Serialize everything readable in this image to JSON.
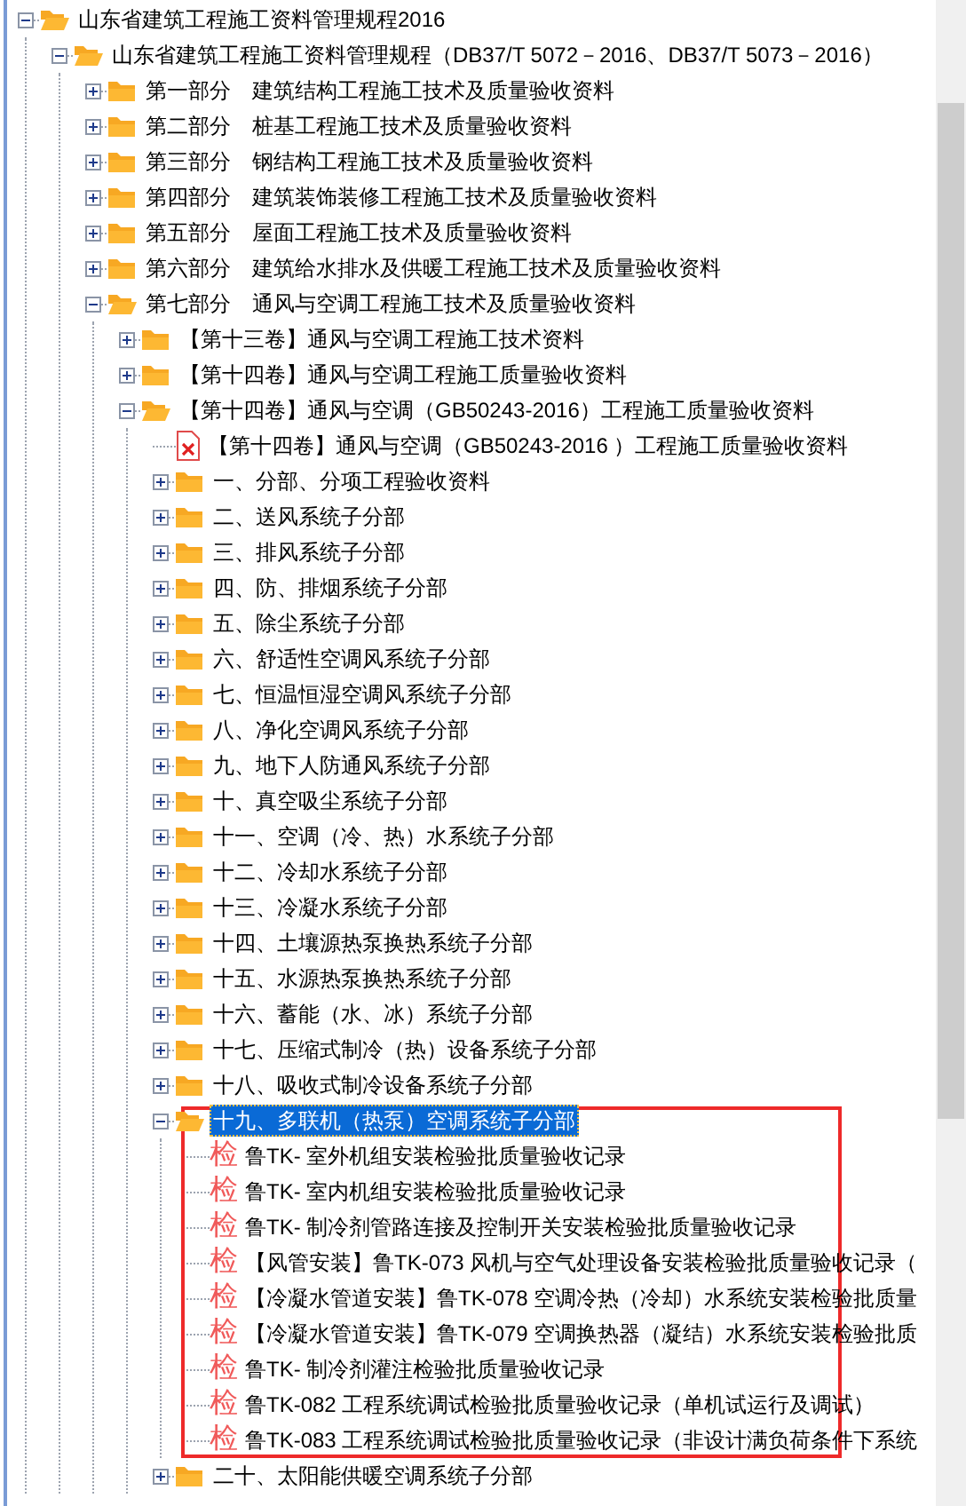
{
  "tree": [
    {
      "label": "山东省建筑工程施工资料管理规程2016",
      "kind": "folder",
      "expanded": true,
      "selected": false,
      "children": [
        {
          "label": "山东省建筑工程施工资料管理规程（DB37/T 5072－2016、DB37/T 5073－2016）",
          "kind": "folder",
          "expanded": true,
          "selected": false,
          "children": [
            {
              "label": "第一部分　建筑结构工程施工技术及质量验收资料",
              "kind": "folder",
              "expanded": false,
              "selected": false
            },
            {
              "label": "第二部分　桩基工程施工技术及质量验收资料",
              "kind": "folder",
              "expanded": false,
              "selected": false
            },
            {
              "label": "第三部分　钢结构工程施工技术及质量验收资料",
              "kind": "folder",
              "expanded": false,
              "selected": false
            },
            {
              "label": "第四部分　建筑装饰装修工程施工技术及质量验收资料",
              "kind": "folder",
              "expanded": false,
              "selected": false
            },
            {
              "label": "第五部分　屋面工程施工技术及质量验收资料",
              "kind": "folder",
              "expanded": false,
              "selected": false
            },
            {
              "label": "第六部分　建筑给水排水及供暖工程施工技术及质量验收资料",
              "kind": "folder",
              "expanded": false,
              "selected": false
            },
            {
              "label": "第七部分　通风与空调工程施工技术及质量验收资料",
              "kind": "folder",
              "expanded": true,
              "selected": false,
              "children": [
                {
                  "label": "【第十三卷】通风与空调工程施工技术资料",
                  "kind": "folder",
                  "expanded": false,
                  "selected": false
                },
                {
                  "label": "【第十四卷】通风与空调工程施工质量验收资料",
                  "kind": "folder",
                  "expanded": false,
                  "selected": false
                },
                {
                  "label": "【第十四卷】通风与空调（GB50243-2016）工程施工质量验收资料",
                  "kind": "folder",
                  "expanded": true,
                  "selected": false,
                  "children": [
                    {
                      "label": "【第十四卷】通风与空调（GB50243-2016 ）工程施工质量验收资料",
                      "kind": "pdf",
                      "selected": false
                    },
                    {
                      "label": "一、分部、分项工程验收资料",
                      "kind": "folder",
                      "expanded": false,
                      "selected": false
                    },
                    {
                      "label": "二、送风系统子分部",
                      "kind": "folder",
                      "expanded": false,
                      "selected": false
                    },
                    {
                      "label": "三、排风系统子分部",
                      "kind": "folder",
                      "expanded": false,
                      "selected": false
                    },
                    {
                      "label": "四、防、排烟系统子分部",
                      "kind": "folder",
                      "expanded": false,
                      "selected": false
                    },
                    {
                      "label": "五、除尘系统子分部",
                      "kind": "folder",
                      "expanded": false,
                      "selected": false
                    },
                    {
                      "label": "六、舒适性空调风系统子分部",
                      "kind": "folder",
                      "expanded": false,
                      "selected": false
                    },
                    {
                      "label": "七、恒温恒湿空调风系统子分部",
                      "kind": "folder",
                      "expanded": false,
                      "selected": false
                    },
                    {
                      "label": "八、净化空调风系统子分部",
                      "kind": "folder",
                      "expanded": false,
                      "selected": false
                    },
                    {
                      "label": "九、地下人防通风系统子分部",
                      "kind": "folder",
                      "expanded": false,
                      "selected": false
                    },
                    {
                      "label": "十、真空吸尘系统子分部",
                      "kind": "folder",
                      "expanded": false,
                      "selected": false
                    },
                    {
                      "label": "十一、空调（冷、热）水系统子分部",
                      "kind": "folder",
                      "expanded": false,
                      "selected": false
                    },
                    {
                      "label": "十二、冷却水系统子分部",
                      "kind": "folder",
                      "expanded": false,
                      "selected": false
                    },
                    {
                      "label": "十三、冷凝水系统子分部",
                      "kind": "folder",
                      "expanded": false,
                      "selected": false
                    },
                    {
                      "label": "十四、土壤源热泵换热系统子分部",
                      "kind": "folder",
                      "expanded": false,
                      "selected": false
                    },
                    {
                      "label": "十五、水源热泵换热系统子分部",
                      "kind": "folder",
                      "expanded": false,
                      "selected": false
                    },
                    {
                      "label": "十六、蓄能（水、冰）系统子分部",
                      "kind": "folder",
                      "expanded": false,
                      "selected": false
                    },
                    {
                      "label": "十七、压缩式制冷（热）设备系统子分部",
                      "kind": "folder",
                      "expanded": false,
                      "selected": false
                    },
                    {
                      "label": "十八、吸收式制冷设备系统子分部",
                      "kind": "folder",
                      "expanded": false,
                      "selected": false
                    },
                    {
                      "label": "十九、多联机（热泵）空调系统子分部",
                      "kind": "folder",
                      "expanded": true,
                      "selected": true,
                      "children": [
                        {
                          "label": "鲁TK- 室外机组安装检验批质量验收记录",
                          "kind": "check",
                          "icon": "检",
                          "selected": false
                        },
                        {
                          "label": "鲁TK- 室内机组安装检验批质量验收记录",
                          "kind": "check",
                          "icon": "检",
                          "selected": false
                        },
                        {
                          "label": "鲁TK- 制冷剂管路连接及控制开关安装检验批质量验收记录",
                          "kind": "check",
                          "icon": "检",
                          "selected": false
                        },
                        {
                          "label": "【风管安装】鲁TK-073 风机与空气处理设备安装检验批质量验收记录（",
                          "kind": "check",
                          "icon": "检",
                          "selected": false
                        },
                        {
                          "label": "【冷凝水管道安装】鲁TK-078 空调冷热（冷却）水系统安装检验批质量",
                          "kind": "check",
                          "icon": "检",
                          "selected": false
                        },
                        {
                          "label": "【冷凝水管道安装】鲁TK-079 空调换热器（凝结）水系统安装检验批质",
                          "kind": "check",
                          "icon": "检",
                          "selected": false
                        },
                        {
                          "label": "鲁TK- 制冷剂灌注检验批质量验收记录",
                          "kind": "check",
                          "icon": "检",
                          "selected": false
                        },
                        {
                          "label": "鲁TK-082 工程系统调试检验批质量验收记录（单机试运行及调试）",
                          "kind": "check",
                          "icon": "检",
                          "selected": false
                        },
                        {
                          "label": "鲁TK-083 工程系统调试检验批质量验收记录（非设计满负荷条件下系统",
                          "kind": "check",
                          "icon": "检",
                          "selected": false
                        }
                      ]
                    },
                    {
                      "label": "二十、太阳能供暖空调系统子分部",
                      "kind": "folder",
                      "expanded": false,
                      "selected": false
                    }
                  ]
                }
              ]
            }
          ]
        }
      ]
    }
  ]
}
